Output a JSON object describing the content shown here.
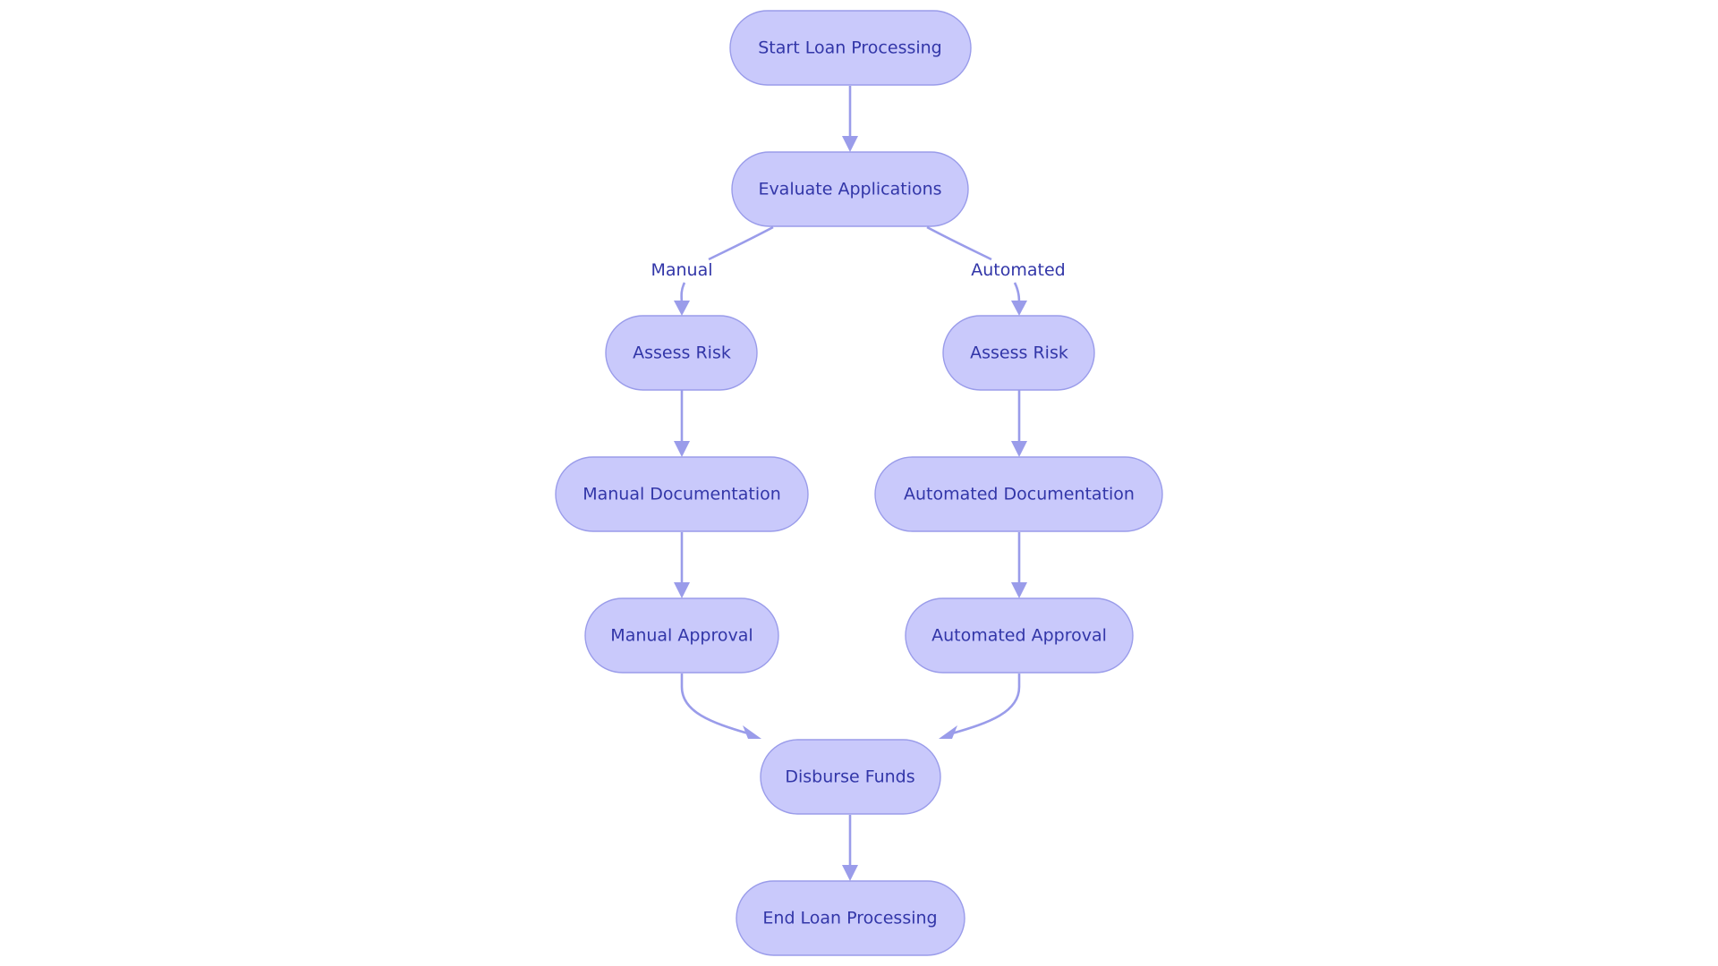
{
  "diagram": {
    "type": "flowchart",
    "direction": "top-to-bottom",
    "colors": {
      "node_fill": "#c9c9fb",
      "node_stroke": "#9a9cea",
      "text": "#3236a8",
      "edge": "#9a9cea",
      "background": "#ffffff"
    },
    "nodes": [
      {
        "id": "start",
        "label": "Start Loan Processing"
      },
      {
        "id": "evaluate",
        "label": "Evaluate Applications"
      },
      {
        "id": "assess_manual",
        "label": "Assess Risk"
      },
      {
        "id": "assess_auto",
        "label": "Assess Risk"
      },
      {
        "id": "manual_doc",
        "label": "Manual Documentation"
      },
      {
        "id": "auto_doc",
        "label": "Automated Documentation"
      },
      {
        "id": "manual_approval",
        "label": "Manual Approval"
      },
      {
        "id": "auto_approval",
        "label": "Automated Approval"
      },
      {
        "id": "disburse",
        "label": "Disburse Funds"
      },
      {
        "id": "end",
        "label": "End Loan Processing"
      }
    ],
    "edges": [
      {
        "from": "start",
        "to": "evaluate",
        "label": ""
      },
      {
        "from": "evaluate",
        "to": "assess_manual",
        "label": "Manual"
      },
      {
        "from": "evaluate",
        "to": "assess_auto",
        "label": "Automated"
      },
      {
        "from": "assess_manual",
        "to": "manual_doc",
        "label": ""
      },
      {
        "from": "assess_auto",
        "to": "auto_doc",
        "label": ""
      },
      {
        "from": "manual_doc",
        "to": "manual_approval",
        "label": ""
      },
      {
        "from": "auto_doc",
        "to": "auto_approval",
        "label": ""
      },
      {
        "from": "manual_approval",
        "to": "disburse",
        "label": ""
      },
      {
        "from": "auto_approval",
        "to": "disburse",
        "label": ""
      },
      {
        "from": "disburse",
        "to": "end",
        "label": ""
      }
    ]
  }
}
